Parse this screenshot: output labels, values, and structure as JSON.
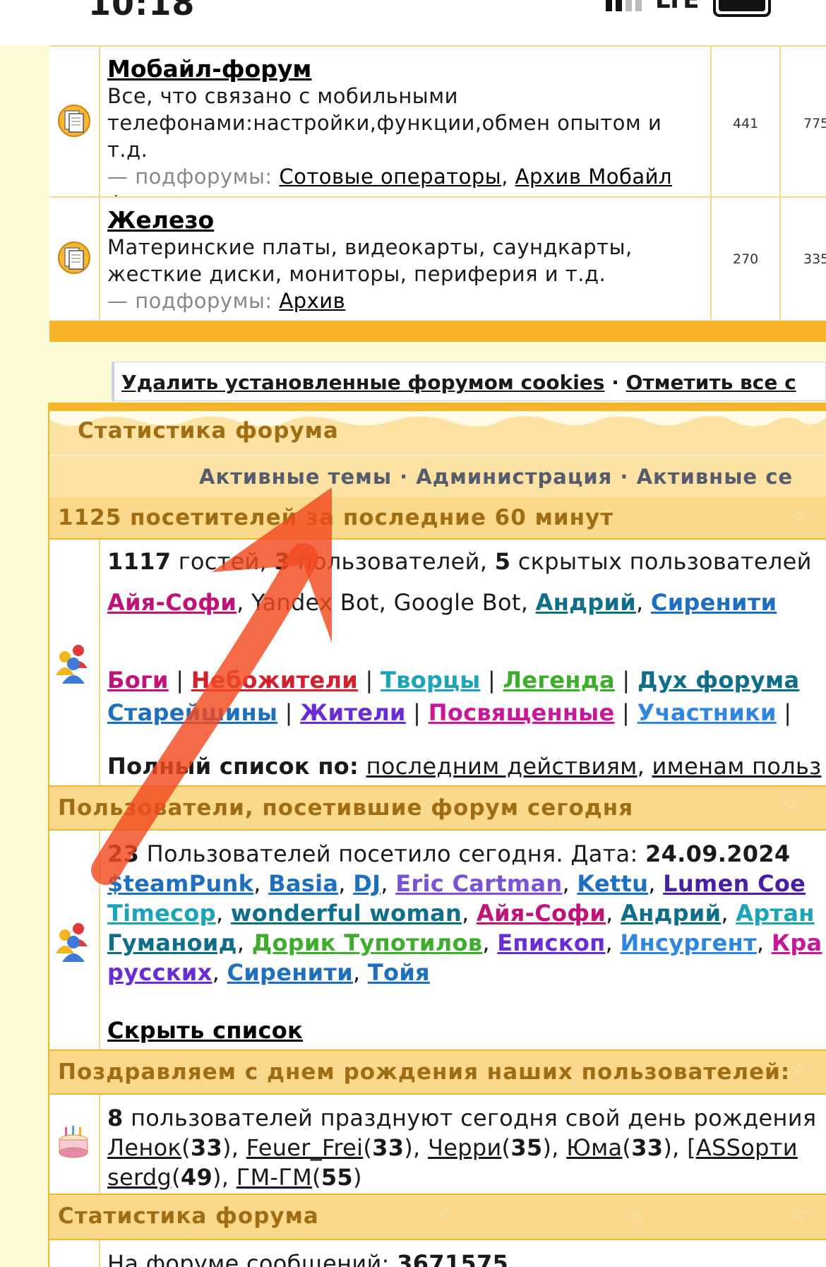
{
  "status": {
    "time": "10:18",
    "network": "LTE"
  },
  "forums": [
    {
      "title": "Мобайл-форум",
      "desc1": "Все, что связано с мобильными",
      "desc2": "телефонами:настройки,функции,обмен опытом и т.д.",
      "sub_label": "— подфорумы:",
      "sub1": "Сотовые операторы",
      "sub2a": "Архив Мобайл",
      "sub2b": "форума",
      "topics": "441",
      "posts": "775"
    },
    {
      "title": "Железо",
      "desc1": "Материнские платы, видеокарты, саундкарты,",
      "desc2": "жесткие диски, мониторы, периферия и т.д.",
      "sub_label": "— подфорумы:",
      "sub1": "Архив",
      "topics": "270",
      "posts": "335"
    }
  ],
  "cookies_bar": {
    "delete_cookies": "Удалить установленные форумом cookies",
    "dot": "·",
    "mark_all": "Отметить все с"
  },
  "stats": {
    "title": "Статистика форума",
    "nav": {
      "active_topics": "Активные темы",
      "admin": "Администрация",
      "active_sessions": "Активные се",
      "dot": "·"
    },
    "online_header": "1125 посетителей за последние 60 минут",
    "online": {
      "guests_num": "1117",
      "guests_word": "гостей,",
      "users_num": "3",
      "users_word": "пользователей,",
      "hidden_num": "5",
      "hidden_word": "скрытых пользователей",
      "users": [
        {
          "name": "Айя-Софи",
          "color": "#c0137a"
        },
        {
          "name": "Yandex Bot",
          "color": "#1a1a1a"
        },
        {
          "name": "Google Bot",
          "color": "#1a1a1a"
        },
        {
          "name": "Андрий",
          "color": "#0f6e8a"
        },
        {
          "name": "Сиренити",
          "color": "#1e6fc0"
        }
      ],
      "groups": [
        {
          "name": "Боги",
          "color": "#c0137a"
        },
        {
          "name": "Небожители",
          "color": "#d3212d"
        },
        {
          "name": "Творцы",
          "color": "#1ba4b7"
        },
        {
          "name": "Легенда",
          "color": "#3dae2b"
        },
        {
          "name": "Дух форума",
          "color": "#0f6e8a"
        },
        {
          "name": "Старейшины",
          "color": "#1e6fc0"
        },
        {
          "name": "Жители",
          "color": "#6a2cd6"
        },
        {
          "name": "Посвященные",
          "color": "#c8189a"
        },
        {
          "name": "Участники",
          "color": "#2f86e0"
        }
      ],
      "full_list_label": "Полный список по:",
      "by_actions": "последним действиям",
      "by_names": "именам польз"
    },
    "today_header": "Пользователи, посетившие форум сегодня",
    "today": {
      "count": "23",
      "text": "Пользователей посетило сегодня. Дата:",
      "date": "24.09.2024",
      "users": [
        {
          "name": "$teamPunk",
          "color": "#1e6fc0"
        },
        {
          "name": "Basia",
          "color": "#1e6fc0"
        },
        {
          "name": "DJ",
          "color": "#1e6fc0"
        },
        {
          "name": "Eric Cartman",
          "color": "#7a52d6"
        },
        {
          "name": "Kettu",
          "color": "#1e6fc0"
        },
        {
          "name": "Lumen Coe",
          "color": "#4b1fa3"
        },
        {
          "name": "Timecop",
          "color": "#1ba4b7"
        },
        {
          "name": "wonderful woman",
          "color": "#0f6e8a"
        },
        {
          "name": "Айя-Софи",
          "color": "#c0137a"
        },
        {
          "name": "Андрий",
          "color": "#0f6e8a"
        },
        {
          "name": "Артан",
          "color": "#1ba4b7"
        },
        {
          "name": "Гуманоид",
          "color": "#0f6e8a"
        },
        {
          "name": "Дорик Тупотилов",
          "color": "#3dae2b"
        },
        {
          "name": "Епископ",
          "color": "#6a2cd6"
        },
        {
          "name": "Инсургент",
          "color": "#2f86e0"
        },
        {
          "name": "Кра",
          "color": "#c8189a"
        },
        {
          "name": "русских",
          "color": "#6a2cd6"
        },
        {
          "name": "Сиренити",
          "color": "#1e6fc0"
        },
        {
          "name": "Тойя",
          "color": "#1e6fc0"
        }
      ],
      "hide_list": "Скрыть список"
    },
    "birthday_header": "Поздравляем с днем рождения наших пользователей:",
    "birthday": {
      "count": "8",
      "text": "пользователей празднуют сегодня свой день рождения",
      "users": [
        {
          "name": "Ленок",
          "age": "33"
        },
        {
          "name": "Feuer_Frei",
          "age": "33"
        },
        {
          "name": "Черри",
          "age": "35"
        },
        {
          "name": "Юма",
          "age": "33"
        },
        {
          "name": "[ASSорти",
          "age": ""
        },
        {
          "name": "serdg",
          "age": "49"
        },
        {
          "name": "ГМ-ГМ",
          "age": "55"
        }
      ]
    },
    "stats_header": "Статистика форума",
    "messages_label": "На форуме сообщений:",
    "messages_count": "3671575"
  }
}
